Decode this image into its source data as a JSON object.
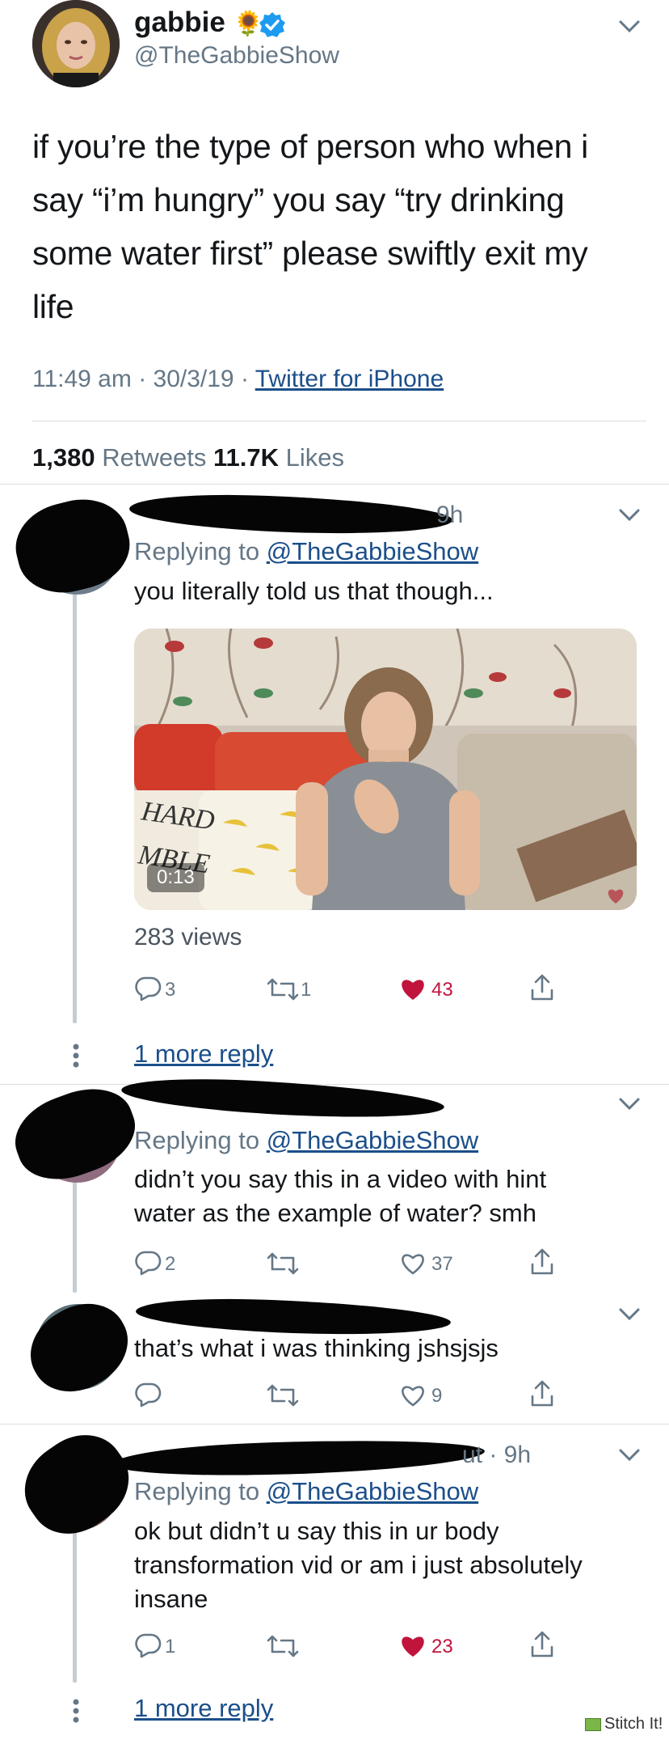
{
  "main_tweet": {
    "name": "gabbie",
    "name_emoji": "🌻",
    "handle": "@TheGabbieShow",
    "text_lines": [
      "if you’re the type of person who when i",
      "say “i’m hungry” you say “try drinking",
      "some water first” please swiftly exit my",
      "life"
    ],
    "time": "11:49 am · 30/3/19 · ",
    "source": "Twitter for iPhone",
    "retweets_count": "1,380",
    "retweets_label": " Retweets  ",
    "likes_count": "11.7K",
    "likes_label": " Likes"
  },
  "replies": [
    {
      "time_fragment": "9h",
      "replying_prefix": "Replying to ",
      "replying_handle": "@TheGabbieShow",
      "text_lines": [
        "you literally told us that though..."
      ],
      "video": {
        "duration": "0:13",
        "views": "283 views",
        "wall_text_1": "HARD",
        "wall_text_2": "MBLE"
      },
      "reply_count": "3",
      "retweet_count": "1",
      "like_count": "43",
      "liked": true,
      "more_replies": "1 more reply"
    },
    {
      "replying_prefix": "Replying to ",
      "replying_handle": "@TheGabbieShow",
      "text_lines": [
        "didn’t you say this in a video with hint",
        "water as the example of water? smh"
      ],
      "reply_count": "2",
      "retweet_count": "",
      "like_count": "37",
      "liked": false
    },
    {
      "text_lines": [
        "that’s what i was thinking jshsjsjs"
      ],
      "reply_count": "",
      "retweet_count": "",
      "like_count": "9",
      "liked": false
    },
    {
      "time_fragment": "ut · 9h",
      "replying_prefix": "Replying to ",
      "replying_handle": "@TheGabbieShow",
      "text_lines": [
        "ok but didn’t u say this in ur body",
        "transformation vid or am i just absolutely",
        "insane"
      ],
      "reply_count": "1",
      "retweet_count": "",
      "like_count": "23",
      "liked": true,
      "more_replies": "1 more reply"
    }
  ],
  "watermark": "Stitch It!",
  "colors": {
    "link": "#1b4f8a",
    "like_red": "#c0143c",
    "grey": "#657786",
    "verified": "#1d9bf0"
  },
  "icons": [
    "chevron-down-icon",
    "verified-badge-icon",
    "reply-icon",
    "retweet-icon",
    "like-icon",
    "share-icon",
    "more-dots-icon"
  ]
}
